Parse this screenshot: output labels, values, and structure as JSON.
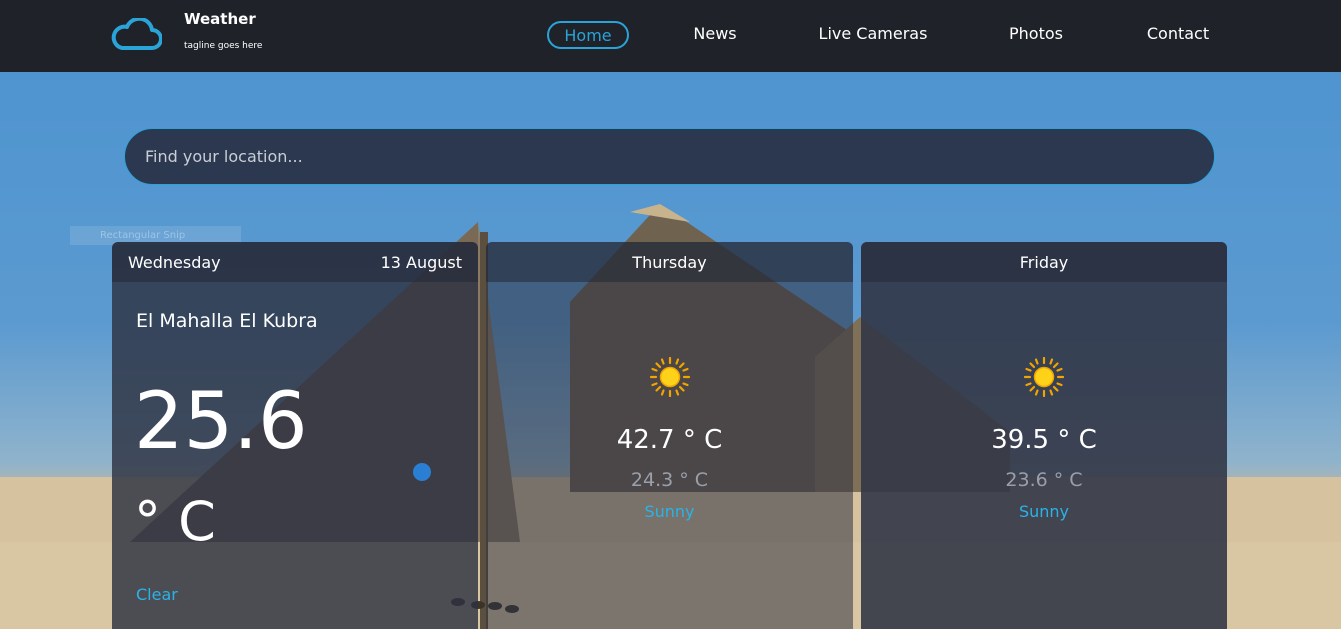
{
  "brand": {
    "title": "Weather",
    "tagline": "tagline goes here",
    "logo_icon": "cloud-icon",
    "accent": "#2aa3d8"
  },
  "nav": {
    "items": [
      {
        "label": "Home",
        "active": true
      },
      {
        "label": "News",
        "active": false
      },
      {
        "label": "Live Cameras",
        "active": false
      },
      {
        "label": "Photos",
        "active": false
      },
      {
        "label": "Contact",
        "active": false
      }
    ]
  },
  "search": {
    "placeholder": "Find your location...",
    "value": ""
  },
  "overlay_ghost": {
    "label": "Rectangular Snip"
  },
  "forecast": {
    "today": {
      "day": "Wednesday",
      "date": "13 August",
      "city": "El Mahalla El Kubra",
      "temp": "25.6",
      "unit": "° C",
      "icon": "moon-icon",
      "condition": "Clear"
    },
    "next": [
      {
        "day": "Thursday",
        "icon": "sun-icon",
        "max": "42.7 ° C",
        "min": "24.3 ° C",
        "condition": "Sunny"
      },
      {
        "day": "Friday",
        "icon": "sun-icon",
        "max": "39.5 ° C",
        "min": "23.6 ° C",
        "condition": "Sunny"
      }
    ]
  },
  "colors": {
    "header_bg": "#1f2329",
    "condition_text": "#2ab3e8",
    "muted_temp": "#9aa0ab"
  }
}
